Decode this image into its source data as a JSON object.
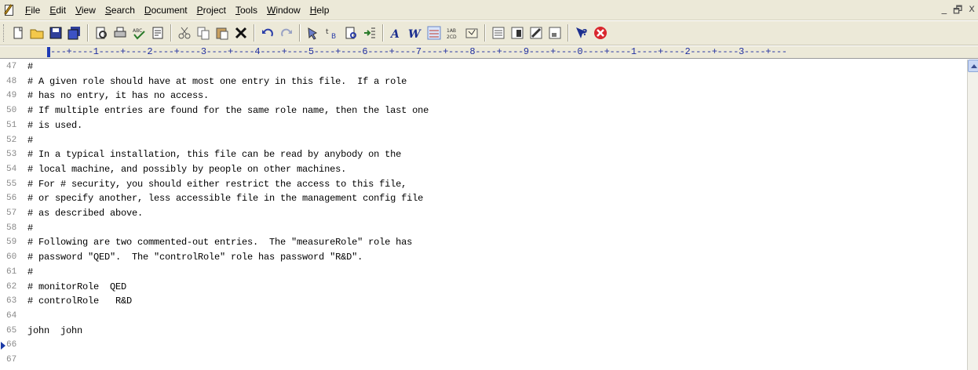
{
  "menu": [
    {
      "label": "File",
      "key": "F",
      "rest": "ile"
    },
    {
      "label": "Edit",
      "key": "E",
      "rest": "dit"
    },
    {
      "label": "View",
      "key": "V",
      "rest": "iew"
    },
    {
      "label": "Search",
      "key": "S",
      "rest": "earch"
    },
    {
      "label": "Document",
      "key": "D",
      "rest": "ocument"
    },
    {
      "label": "Project",
      "key": "P",
      "rest": "roject"
    },
    {
      "label": "Tools",
      "key": "T",
      "rest": "ools"
    },
    {
      "label": "Window",
      "key": "W",
      "rest": "indow"
    },
    {
      "label": "Help",
      "key": "H",
      "rest": "elp"
    }
  ],
  "window_controls": {
    "minimize": "_",
    "restore": "🗗",
    "close": "x"
  },
  "toolbar": {
    "icons": [
      "new-file-icon",
      "open-folder-icon",
      "save-icon",
      "save-all-icon",
      "sep",
      "print-preview-icon",
      "print-icon",
      "spell-check-icon",
      "word-wrap-icon",
      "sep",
      "cut-icon",
      "copy-icon",
      "paste-icon",
      "delete-icon",
      "sep",
      "undo-icon",
      "redo-icon",
      "sep",
      "find-icon",
      "replace-icon",
      "find-in-files-icon",
      "indent-icon",
      "sep",
      "font-icon",
      "word-icon",
      "wrap-lines-icon",
      "number-lines-icon",
      "settings-icon",
      "sep",
      "hex-view-icon",
      "column-mode-icon",
      "clipboard-icon",
      "ftp-icon",
      "sep",
      "help-icon",
      "stop-icon"
    ]
  },
  "ruler": "---+----1----+----2----+----3----+----4----+----5----+----6----+----7----+----8----+----9----+----0----+----1----+----2----+----3----+---",
  "editor": {
    "lines": [
      {
        "n": "47",
        "t": "#"
      },
      {
        "n": "48",
        "t": "# A given role should have at most one entry in this file.  If a role"
      },
      {
        "n": "49",
        "t": "# has no entry, it has no access."
      },
      {
        "n": "50",
        "t": "# If multiple entries are found for the same role name, then the last one"
      },
      {
        "n": "51",
        "t": "# is used."
      },
      {
        "n": "52",
        "t": "#"
      },
      {
        "n": "53",
        "t": "# In a typical installation, this file can be read by anybody on the"
      },
      {
        "n": "54",
        "t": "# local machine, and possibly by people on other machines."
      },
      {
        "n": "55",
        "t": "# For # security, you should either restrict the access to this file,"
      },
      {
        "n": "56",
        "t": "# or specify another, less accessible file in the management config file"
      },
      {
        "n": "57",
        "t": "# as described above."
      },
      {
        "n": "58",
        "t": "#"
      },
      {
        "n": "59",
        "t": "# Following are two commented-out entries.  The \"measureRole\" role has"
      },
      {
        "n": "60",
        "t": "# password \"QED\".  The \"controlRole\" role has password \"R&D\"."
      },
      {
        "n": "61",
        "t": "#"
      },
      {
        "n": "62",
        "t": "# monitorRole  QED"
      },
      {
        "n": "63",
        "t": "# controlRole   R&D"
      },
      {
        "n": "64",
        "t": ""
      },
      {
        "n": "65",
        "t": "john  john"
      },
      {
        "n": "66",
        "t": ""
      },
      {
        "n": "67",
        "t": ""
      }
    ],
    "current_line": "66"
  },
  "colors": {
    "chrome": "#ece9d8",
    "ruler_text": "#1f2ea0",
    "line_numbers": "#888888",
    "marker": "#1b3aa6"
  }
}
